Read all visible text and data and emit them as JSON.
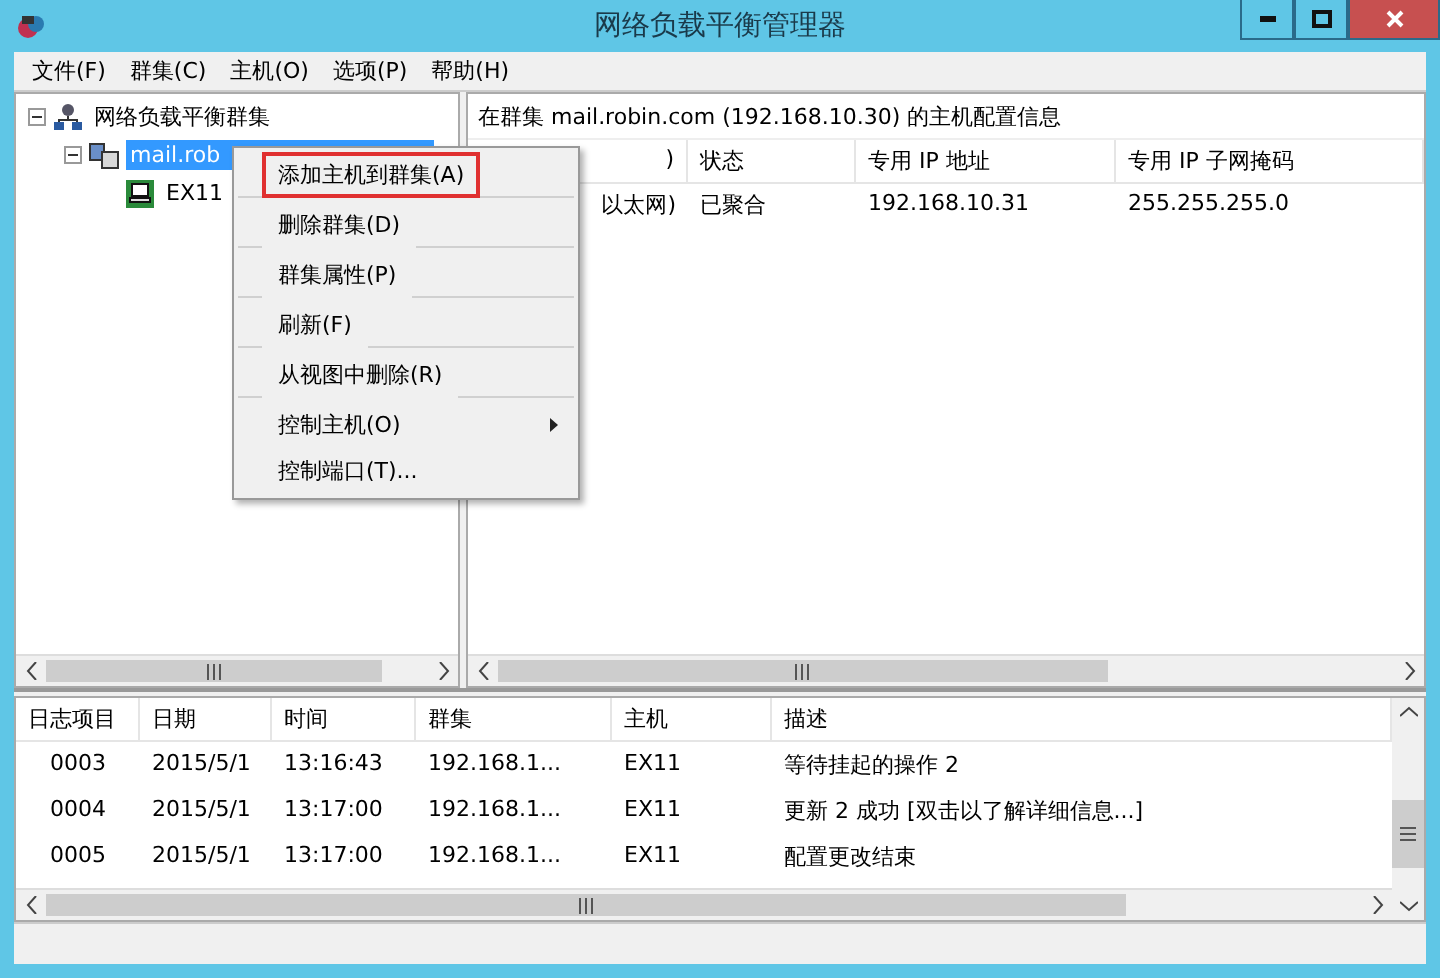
{
  "window": {
    "title": "网络负载平衡管理器"
  },
  "menu": [
    "文件(F)",
    "群集(C)",
    "主机(O)",
    "选项(P)",
    "帮助(H)"
  ],
  "tree": [
    {
      "label": "网络负载平衡群集",
      "kind": "root",
      "expanded": true,
      "children": [
        {
          "label": "mail.rob",
          "kind": "cluster",
          "selected": true,
          "expanded": true,
          "children": [
            {
              "label": "EX11",
              "kind": "host",
              "selected": false
            }
          ]
        }
      ]
    }
  ],
  "details": {
    "heading": "在群集 mail.robin.com (192.168.10.30) 的主机配置信息",
    "columns": [
      ")",
      "状态",
      "专用 IP 地址",
      "专用 IP 子网掩码"
    ],
    "rows": [
      [
        "以太网)",
        "已聚合",
        "192.168.10.31",
        "255.255.255.0"
      ]
    ]
  },
  "context_menu": [
    {
      "label": "添加主机到群集(A)",
      "highlighted": true,
      "submenu": false,
      "separator_after": true
    },
    {
      "label": "删除群集(D)",
      "highlighted": false,
      "submenu": false,
      "separator_after": true
    },
    {
      "label": "群集属性(P)",
      "highlighted": false,
      "submenu": false,
      "separator_after": true
    },
    {
      "label": "刷新(F)",
      "highlighted": false,
      "submenu": false,
      "separator_after": true
    },
    {
      "label": "从视图中删除(R)",
      "highlighted": false,
      "submenu": false,
      "separator_after": true
    },
    {
      "label": "控制主机(O)",
      "highlighted": false,
      "submenu": true,
      "separator_after": false
    },
    {
      "label": "控制端口(T)...",
      "highlighted": false,
      "submenu": false,
      "separator_after": false
    }
  ],
  "log": {
    "columns": [
      "日志项目",
      "日期",
      "时间",
      "群集",
      "主机",
      "描述"
    ],
    "rows": [
      [
        "0003",
        "2015/5/1",
        "13:16:43",
        "192.168.1...",
        "EX11",
        "等待挂起的操作 2"
      ],
      [
        "0004",
        "2015/5/1",
        "13:17:00",
        "192.168.1...",
        "EX11",
        "更新 2 成功 [双击以了解详细信息...]"
      ],
      [
        "0005",
        "2015/5/1",
        "13:17:00",
        "192.168.1...",
        "EX11",
        "配置更改结束"
      ]
    ]
  }
}
